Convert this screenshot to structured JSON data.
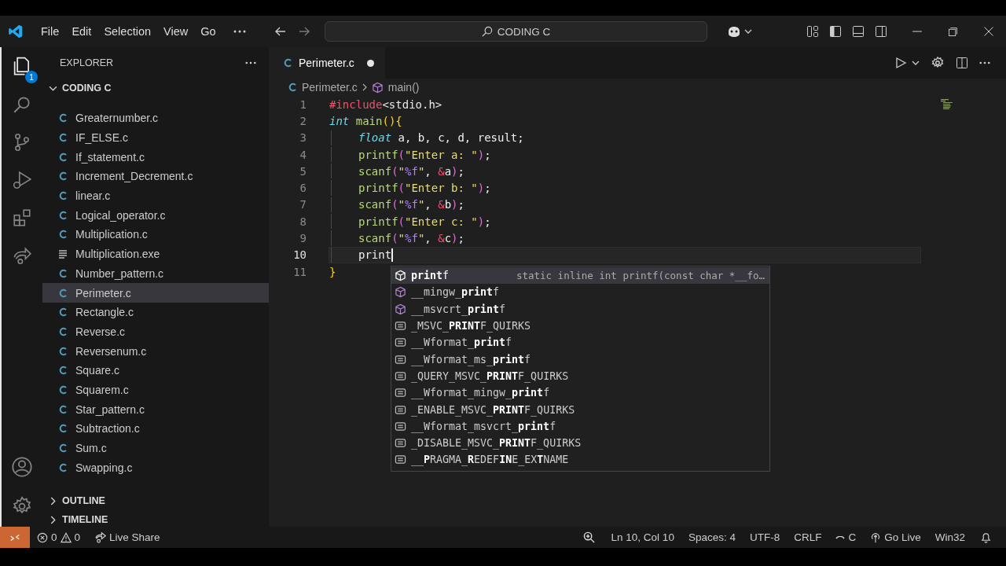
{
  "window": {
    "title": "CODING C"
  },
  "menu": [
    "File",
    "Edit",
    "Selection",
    "View",
    "Go"
  ],
  "activity_bar": {
    "explorer_badge": "1"
  },
  "sidebar": {
    "title": "EXPLORER",
    "folder": {
      "name": "CODING C",
      "expanded": true
    },
    "files": [
      {
        "name": "Greaternumber.c",
        "kind": "c",
        "selected": false
      },
      {
        "name": "IF_ELSE.c",
        "kind": "c",
        "selected": false
      },
      {
        "name": "If_statement.c",
        "kind": "c",
        "selected": false
      },
      {
        "name": "Increment_Decrement.c",
        "kind": "c",
        "selected": false
      },
      {
        "name": "linear.c",
        "kind": "c",
        "selected": false
      },
      {
        "name": "Logical_operator.c",
        "kind": "c",
        "selected": false
      },
      {
        "name": "Multiplication.c",
        "kind": "c",
        "selected": false
      },
      {
        "name": "Multiplication.exe",
        "kind": "exe",
        "selected": false
      },
      {
        "name": "Number_pattern.c",
        "kind": "c",
        "selected": false
      },
      {
        "name": "Perimeter.c",
        "kind": "c",
        "selected": true
      },
      {
        "name": "Rectangle.c",
        "kind": "c",
        "selected": false
      },
      {
        "name": "Reverse.c",
        "kind": "c",
        "selected": false
      },
      {
        "name": "Reversenum.c",
        "kind": "c",
        "selected": false
      },
      {
        "name": "Square.c",
        "kind": "c",
        "selected": false
      },
      {
        "name": "Squarem.c",
        "kind": "c",
        "selected": false
      },
      {
        "name": "Star_pattern.c",
        "kind": "c",
        "selected": false
      },
      {
        "name": "Subtraction.c",
        "kind": "c",
        "selected": false
      },
      {
        "name": "Sum.c",
        "kind": "c",
        "selected": false
      },
      {
        "name": "Swapping.c",
        "kind": "c",
        "selected": false
      }
    ],
    "sections": [
      {
        "name": "OUTLINE",
        "expanded": false
      },
      {
        "name": "TIMELINE",
        "expanded": false
      }
    ]
  },
  "tabs": [
    {
      "label": "Perimeter.c",
      "modified": true,
      "selected": true
    }
  ],
  "breadcrumb": [
    "Perimeter.c",
    "main()"
  ],
  "code": {
    "lines": [
      {
        "number": "1",
        "indented": false,
        "current": false,
        "tokens": [
          {
            "text": "#include",
            "kind": "directive"
          },
          {
            "text": "<stdio.h>",
            "kind": "header"
          }
        ]
      },
      {
        "number": "2",
        "indented": false,
        "current": false,
        "tokens": [
          {
            "text": "int",
            "kind": "keyword"
          },
          {
            "text": " main",
            "kind": "func"
          },
          {
            "text": "()",
            "kind": "bracket1"
          },
          {
            "text": "{",
            "kind": "bracket1"
          }
        ]
      },
      {
        "number": "3",
        "indented": true,
        "current": false,
        "tokens": [
          {
            "text": "float",
            "kind": "keyword"
          },
          {
            "text": " a, b, c, d, result;",
            "kind": "plain"
          }
        ]
      },
      {
        "number": "4",
        "indented": true,
        "current": false,
        "tokens": [
          {
            "text": "printf",
            "kind": "func"
          },
          {
            "text": "(",
            "kind": "bracket2"
          },
          {
            "text": "\"Enter a: \"",
            "kind": "string"
          },
          {
            "text": ")",
            "kind": "bracket2"
          },
          {
            "text": ";",
            "kind": "plain"
          }
        ]
      },
      {
        "number": "5",
        "indented": true,
        "current": false,
        "tokens": [
          {
            "text": "scanf",
            "kind": "func"
          },
          {
            "text": "(",
            "kind": "bracket2"
          },
          {
            "text": "\"",
            "kind": "string"
          },
          {
            "text": "%f",
            "kind": "format"
          },
          {
            "text": "\"",
            "kind": "string"
          },
          {
            "text": ", ",
            "kind": "plain"
          },
          {
            "text": "&",
            "kind": "amp"
          },
          {
            "text": "a",
            "kind": "plain"
          },
          {
            "text": ")",
            "kind": "bracket2"
          },
          {
            "text": ";",
            "kind": "plain"
          }
        ]
      },
      {
        "number": "6",
        "indented": true,
        "current": false,
        "tokens": [
          {
            "text": "printf",
            "kind": "func"
          },
          {
            "text": "(",
            "kind": "bracket2"
          },
          {
            "text": "\"Enter b: \"",
            "kind": "string"
          },
          {
            "text": ")",
            "kind": "bracket2"
          },
          {
            "text": ";",
            "kind": "plain"
          }
        ]
      },
      {
        "number": "7",
        "indented": true,
        "current": false,
        "tokens": [
          {
            "text": "scanf",
            "kind": "func"
          },
          {
            "text": "(",
            "kind": "bracket2"
          },
          {
            "text": "\"",
            "kind": "string"
          },
          {
            "text": "%f",
            "kind": "format"
          },
          {
            "text": "\"",
            "kind": "string"
          },
          {
            "text": ", ",
            "kind": "plain"
          },
          {
            "text": "&",
            "kind": "amp"
          },
          {
            "text": "b",
            "kind": "plain"
          },
          {
            "text": ")",
            "kind": "bracket2"
          },
          {
            "text": ";",
            "kind": "plain"
          }
        ]
      },
      {
        "number": "8",
        "indented": true,
        "current": false,
        "tokens": [
          {
            "text": "printf",
            "kind": "func"
          },
          {
            "text": "(",
            "kind": "bracket2"
          },
          {
            "text": "\"Enter c: \"",
            "kind": "string"
          },
          {
            "text": ")",
            "kind": "bracket2"
          },
          {
            "text": ";",
            "kind": "plain"
          }
        ]
      },
      {
        "number": "9",
        "indented": true,
        "current": false,
        "tokens": [
          {
            "text": "scanf",
            "kind": "func"
          },
          {
            "text": "(",
            "kind": "bracket2"
          },
          {
            "text": "\"",
            "kind": "string"
          },
          {
            "text": "%f",
            "kind": "format"
          },
          {
            "text": "\"",
            "kind": "string"
          },
          {
            "text": ", ",
            "kind": "plain"
          },
          {
            "text": "&",
            "kind": "amp"
          },
          {
            "text": "c",
            "kind": "plain"
          },
          {
            "text": ")",
            "kind": "bracket2"
          },
          {
            "text": ";",
            "kind": "plain"
          }
        ]
      },
      {
        "number": "10",
        "indented": true,
        "current": true,
        "tokens": [
          {
            "text": "print",
            "kind": "plain"
          }
        ]
      },
      {
        "number": "11",
        "indented": false,
        "current": false,
        "tokens": [
          {
            "text": "}",
            "kind": "bracket1"
          }
        ]
      }
    ]
  },
  "suggestions": [
    {
      "label": "**print**f",
      "kind": "function",
      "selected": true,
      "detail": "static inline int printf(const char *__fo…"
    },
    {
      "label": "__mingw_**print**f",
      "kind": "function",
      "selected": false
    },
    {
      "label": "__msvcrt_**print**f",
      "kind": "function",
      "selected": false
    },
    {
      "label": "_MSVC_**PRINT**F_QUIRKS",
      "kind": "constant",
      "selected": false
    },
    {
      "label": "__Wformat_**print**f",
      "kind": "constant",
      "selected": false
    },
    {
      "label": "__Wformat_ms_**print**f",
      "kind": "constant",
      "selected": false
    },
    {
      "label": "_QUERY_MSVC_**PRINT**F_QUIRKS",
      "kind": "constant",
      "selected": false
    },
    {
      "label": "__Wformat_mingw_**print**f",
      "kind": "constant",
      "selected": false
    },
    {
      "label": "_ENABLE_MSVC_**PRINT**F_QUIRKS",
      "kind": "constant",
      "selected": false
    },
    {
      "label": "__Wformat_msvcrt_**print**f",
      "kind": "constant",
      "selected": false
    },
    {
      "label": "_DISABLE_MSVC_**PRINT**F_QUIRKS",
      "kind": "constant",
      "selected": false
    },
    {
      "label": "__**P**RAGMA_**R**EDEF**IN**E_EX**T**NAME",
      "kind": "constant",
      "selected": false
    }
  ],
  "status_bar": {
    "errors": "0",
    "warnings": "0",
    "live_share": "Live Share",
    "position": "Ln 10, Col 10",
    "spaces": "Spaces: 4",
    "encoding": "UTF-8",
    "eol": "CRLF",
    "language": "C",
    "go_live": "Go Live",
    "platform": "Win32"
  }
}
